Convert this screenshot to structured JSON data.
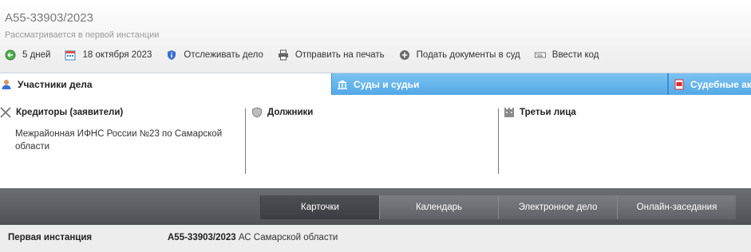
{
  "case": {
    "number": "А55-33903/2023",
    "status": "Рассматривается в первой инстанции"
  },
  "actions": [
    {
      "label": "5 дней",
      "icon": "clock-arrow-icon"
    },
    {
      "label": "18 октября 2023",
      "icon": "calendar-icon"
    },
    {
      "label": "Отслеживать дело",
      "icon": "shield-info-icon"
    },
    {
      "label": "Отправить на печать",
      "icon": "printer-icon"
    },
    {
      "label": "Подать документы в суд",
      "icon": "plus-circle-icon"
    },
    {
      "label": "Ввести код",
      "icon": "keyboard-icon"
    }
  ],
  "tabs": {
    "participants": "Участники дела",
    "courts": "Суды и судьи",
    "acts": "Судебные акты"
  },
  "columns": {
    "creditors": {
      "title": "Кредиторы (заявители)",
      "items": [
        "Межрайонная ИФНС России №23 по Самарской области"
      ]
    },
    "debtors": {
      "title": "Должники",
      "items": []
    },
    "third_parties": {
      "title": "Третьи лица",
      "items": []
    }
  },
  "nav_buttons": [
    "Карточки",
    "Календарь",
    "Электронное дело",
    "Онлайн-заседания"
  ],
  "active_nav": "Карточки",
  "instance": {
    "label": "Первая инстанция",
    "case_number": "А55-33903/2023",
    "court": "АС Самарской области"
  },
  "colors": {
    "tab_active_bg": "#ffffff",
    "tab_blue": "#5fb0ea",
    "bar_dark": "#55585c"
  }
}
